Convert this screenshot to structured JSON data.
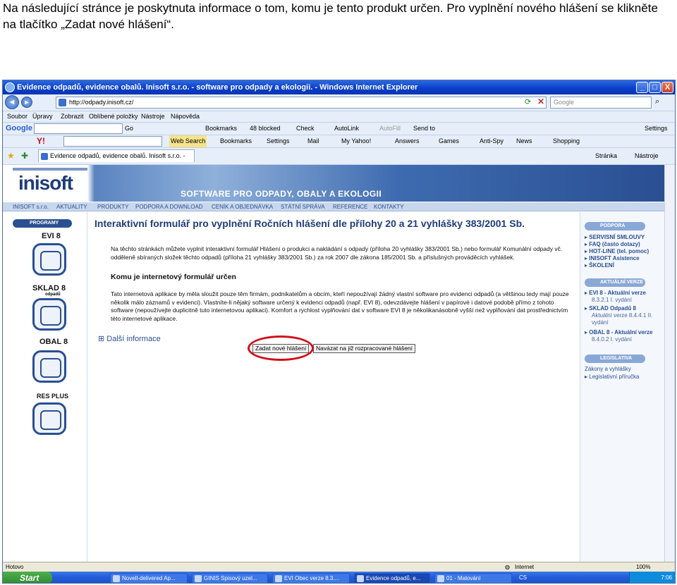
{
  "caption": "Na následující stránce je poskytnuta informace o tom, komu je tento produkt určen. Pro vyplnění nového hlášení se klikněte na tlačítko „Zadat nové hlášení“.",
  "window": {
    "title": "Evidence odpadů, evidence obalů. Inisoft s.r.o. - software pro odpady a ekologii. - Windows Internet Explorer",
    "min": "_",
    "max": "□",
    "close": "X"
  },
  "address": {
    "url": "http://odpady.inisoft.cz/",
    "search_placeholder": "Google",
    "back": "◄",
    "forward": "►"
  },
  "menubar": [
    "Soubor",
    "Úpravy",
    "Zobrazit",
    "Oblíbené položky",
    "Nástroje",
    "Nápověda"
  ],
  "google_toolbar": {
    "logo": "Google",
    "go": "Go",
    "bookmarks": "Bookmarks",
    "blocked": "48 blocked",
    "check": "Check",
    "autolink": "AutoLink",
    "autofill": "AutoFill",
    "sendto": "Send to",
    "settings": "Settings"
  },
  "yahoo_toolbar": {
    "logo": "Y!",
    "websearch": "Web Search",
    "bookmarks": "Bookmarks",
    "settings": "Settings",
    "mail": "Mail",
    "myyahoo": "My Yahoo!",
    "answers": "Answers",
    "games": "Games",
    "antispy": "Anti-Spy",
    "news": "News",
    "shopping": "Shopping"
  },
  "tabbar": {
    "tab": "Evidence odpadů, evidence obalů. Inisoft s.r.o. - soft...",
    "stranka": "Stránka",
    "nastroje": "Nástroje"
  },
  "site": {
    "logo": "inisoft",
    "banner": "SOFTWARE PRO ODPADY, OBALY A EKOLOGII",
    "menu": [
      "INISOFT s.r.o.",
      "AKTUALITY",
      "PRODUKTY",
      "PODPORA A DOWNLOAD",
      "CENÍK A OBJEDNÁVKA",
      "STÁTNÍ SPRÁVA",
      "REFERENCE",
      "KONTAKTY"
    ],
    "left": {
      "header": "PROGRAMY",
      "products": [
        "EVI 8",
        "SKLAD 8",
        "OBAL 8",
        "RES PLUS"
      ],
      "sklad_sub": "odpadů"
    },
    "title": "Interaktivní formulář pro vyplnění Ročních hlášení dle přílohy 20 a 21 vyhlášky 383/2001 Sb.",
    "intro": "Na těchto stránkách můžete vyplnit interaktivní formulář Hlášení o produkci a nakládání s odpady (příloha 20 vyhlášky 383/2001 Sb.) nebo formulář Komunální odpady vč. odděleně sbíraných složek těchto odpadů (příloha 21 vyhlášky 383/2001 Sb.) za rok 2007 dle zákona 185/2001 Sb. a příslušných prováděcích vyhlášek.",
    "subtitle": "Komu je internetový formulář určen",
    "body": "Tato internetová aplikace by měla sloužit pouze těm firmám, podnikatelům a obcím, kteří nepoužívají žádný vlastní software pro evidenci odpadů (a většinou tedy mají pouze několik málo záznamů v evidenci). Vlastníte-li nějaký software určený k evidenci odpadů (např. EVI 8), odevzdávejte hlášení v papírové i datové podobě přímo z tohoto software (nepoužívejte duplicitně tuto internetovou aplikaci). Komfort a rychlost vyplňování dat v software EVI 8 je několikanásobně vyšší než vyplňování dat prostřednictvím této internetové aplikace.",
    "more": "Další informace",
    "more_icon": "⊞",
    "btn_new": "Zadat nové hlášení",
    "btn_continue": "Navázat na již rozpracované hlášení",
    "right": {
      "support": "PODPORA",
      "support_links": [
        "SERVISNÍ SMLOUVY",
        "FAQ (často dotazy)",
        "HOT-LINE (tel. pomoc)",
        "INISOFT Asistence",
        "ŠKOLENÍ"
      ],
      "versions": "AKTUÁLNÍ VERZE",
      "v1": "EVI 8 - Aktuální verze",
      "v1b": "8.3.2.1 I. vydání",
      "v2": "SKLAD Odpadů 8",
      "v2b": "Aktuální verze 8.4.4.1 II.",
      "v2c": "vydání",
      "v3": "OBAL 8 - Aktuální verze",
      "v3b": "8.4.0.2 I. vydání",
      "leg": "LEGISLATIVA",
      "leg1": "Zákony a vyhlášky",
      "leg2": "Legislativní příručka"
    }
  },
  "status": {
    "left": "Hotovo",
    "zone": "Internet",
    "zoom": "100%"
  },
  "taskbar": {
    "start": "Start",
    "tasks": [
      "Novell-delivered Ap...",
      "GINIS Spisový uzel...",
      "EVI Obec verze 8.3....",
      "Evidence odpadů, e...",
      "01 - Malování"
    ],
    "cs": "CS",
    "time": "7:06"
  }
}
